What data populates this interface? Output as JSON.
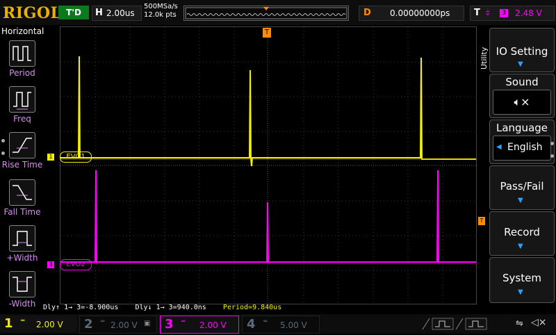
{
  "header": {
    "brand": "RIGOL",
    "run_state": "T'D",
    "horizontal_label": "H",
    "timebase": "2.00us",
    "sample_rate": "500MSa/s",
    "memory_depth": "12.0k pts",
    "delay_label": "D",
    "delay_value": "0.00000000ps",
    "trigger_label": "T",
    "trigger_source": "3",
    "trigger_level": "2.48 V"
  },
  "left_menu": {
    "title": "Horizontal",
    "items": [
      {
        "label": "Period",
        "icon": "period-icon"
      },
      {
        "label": "Freq",
        "icon": "frequency-icon"
      },
      {
        "label": "Rise Time",
        "icon": "rise-time-icon"
      },
      {
        "label": "Fall Time",
        "icon": "fall-time-icon"
      },
      {
        "label": "+Width",
        "icon": "positive-width-icon"
      },
      {
        "label": "-Width",
        "icon": "negative-width-icon"
      }
    ]
  },
  "right_menu": {
    "tab": "Utility",
    "items": [
      {
        "label": "IO Setting",
        "value": ""
      },
      {
        "label": "Sound",
        "value": ""
      },
      {
        "label": "Language",
        "value": "English"
      },
      {
        "label": "Pass/Fail",
        "value": ""
      },
      {
        "label": "Record",
        "value": ""
      },
      {
        "label": "System",
        "value": ""
      }
    ]
  },
  "waveforms": {
    "ch1_label": "EVO1",
    "ch3_label": "EVO2",
    "ch1_marker": "1",
    "ch3_marker": "3",
    "trigger_marker": "T"
  },
  "measurements": {
    "delay_rise": "Dly↑ 1→ 3=-8.900us",
    "delay_fall": "Dly↓ 1→ 3=940.0ns",
    "period": "Period=9.840us"
  },
  "channels": [
    {
      "num": "1",
      "scale": "2.00 V",
      "active": true,
      "color": "#f3f000"
    },
    {
      "num": "2",
      "scale": "2.00 V",
      "active": false,
      "color": "#5a6b7a"
    },
    {
      "num": "3",
      "scale": "2.00 V",
      "active": true,
      "color": "#ff00ff"
    },
    {
      "num": "4",
      "scale": "5.00 V",
      "active": false,
      "color": "#5a6b7a"
    }
  ],
  "colors": {
    "ch1": "#f3f000",
    "ch3": "#ff00ff",
    "trigger": "#ff8c00",
    "brand": "#e8b000"
  }
}
